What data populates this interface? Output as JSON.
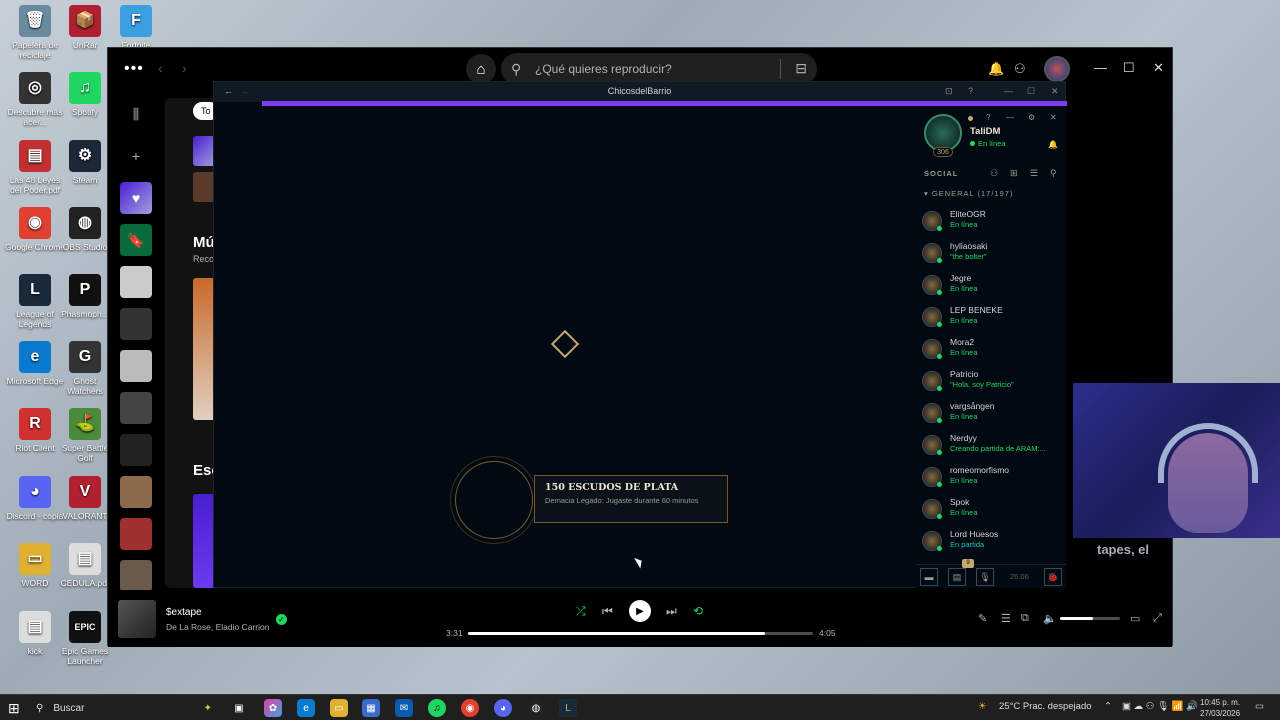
{
  "desktop": {
    "icons": [
      {
        "label": "Papelera de reciclaje",
        "color": "#6a8aa0",
        "glyph": "🗑"
      },
      {
        "label": "UnRar",
        "color": "#b02030",
        "glyph": "📦"
      },
      {
        "label": "Fortnite",
        "color": "#3aa0e0",
        "glyph": "F"
      },
      {
        "label": "Descubre más acer...",
        "color": "#333",
        "glyph": "◎"
      },
      {
        "label": "Spotify",
        "color": "#1ed760",
        "glyph": "♫"
      },
      {
        "label": "Las 48 Leyes del Poder.pdf",
        "color": "#c03030",
        "glyph": "▤"
      },
      {
        "label": "Steam",
        "color": "#1b2838",
        "glyph": "⚙"
      },
      {
        "label": "Google Chrome",
        "color": "#e04030",
        "glyph": "◉"
      },
      {
        "label": "OBS Studio",
        "color": "#222",
        "glyph": "◍"
      },
      {
        "label": "League of Legends",
        "color": "#1a2a3a",
        "glyph": "L"
      },
      {
        "label": "Phasmoph...",
        "color": "#111",
        "glyph": "P"
      },
      {
        "label": "Microsoft Edge",
        "color": "#0a7ad0",
        "glyph": "e"
      },
      {
        "label": "Ghost Watchers",
        "color": "#333",
        "glyph": "G"
      },
      {
        "label": "Riot Client",
        "color": "#d03030",
        "glyph": "R"
      },
      {
        "label": "Super Battle Golf",
        "color": "#4a8a3a",
        "glyph": "⛳"
      },
      {
        "label": "Discord - copia",
        "color": "#5865f2",
        "glyph": "◕"
      },
      {
        "label": "VALORANT",
        "color": "#b02030",
        "glyph": "V"
      },
      {
        "label": "WORD",
        "color": "#e0b030",
        "glyph": "▭"
      },
      {
        "label": "CEDULA.pdf",
        "color": "#ddd",
        "glyph": "▤"
      },
      {
        "label": "kick",
        "color": "#ddd",
        "glyph": "▤"
      },
      {
        "label": "Epic Games Launcher",
        "color": "#111",
        "glyph": "EPIC"
      }
    ]
  },
  "spotify": {
    "search_placeholder": "¿Qué quieres reproducir?",
    "main_tab": "To",
    "heading1": "Mú",
    "sub1": "Reco",
    "heading2": "Esc",
    "player": {
      "title": "$extape",
      "artist": "De La Rose, Eladio Carrion",
      "elapsed": "3:31",
      "duration": "4:05",
      "progress": 0.86,
      "volume": 0.55
    }
  },
  "lol": {
    "window_title": "ChicosdelBarrio",
    "reward": {
      "title": "150 ESCUDOS DE PLATA",
      "desc": "Demacia Legado: Jugaste durante 60 minutos"
    },
    "profile": {
      "name": "TaliDM",
      "status": "En línea",
      "level": "306"
    },
    "social_label": "SOCIAL",
    "group_label": "GENERAL (17/197)",
    "friends": [
      {
        "name": "EliteOGR",
        "status": "En línea",
        "type": "online"
      },
      {
        "name": "hyliaosaki",
        "status": "\"the bolter\"",
        "type": "online"
      },
      {
        "name": "Jegre",
        "status": "En línea",
        "type": "online"
      },
      {
        "name": "LEP BENEKE",
        "status": "En línea",
        "type": "online"
      },
      {
        "name": "Mora2",
        "status": "En línea",
        "type": "online"
      },
      {
        "name": "Patricio",
        "status": "\"Hola, soy Patricio\"",
        "type": "online"
      },
      {
        "name": "vargsången",
        "status": "En línea",
        "type": "online"
      },
      {
        "name": "Nerdyy",
        "status": "Creando partida de ARAM:...",
        "type": "online"
      },
      {
        "name": "romeomorfismo",
        "status": "En línea",
        "type": "online"
      },
      {
        "name": "Spok",
        "status": "En línea",
        "type": "online"
      },
      {
        "name": "Lord Huesos",
        "status": "En partida",
        "type": "ingame"
      }
    ],
    "bottom_version": "26.06",
    "badge_count": "9"
  },
  "webcam_caption": "tapes, el",
  "taskbar": {
    "search_label": "Buscar",
    "weather": "25°C  Prac. despejado",
    "time": "10:45 p. m.",
    "date": "27/03/2026"
  }
}
